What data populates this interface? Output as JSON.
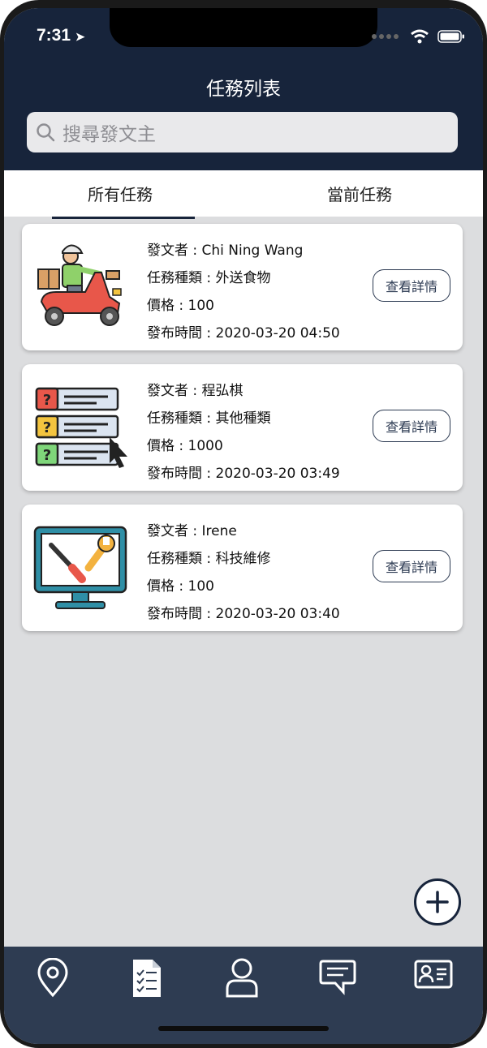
{
  "status": {
    "time": "7:31"
  },
  "header": {
    "title": "任務列表"
  },
  "search": {
    "placeholder": "搜尋發文主"
  },
  "tabs": [
    {
      "label": "所有任務"
    },
    {
      "label": "當前任務"
    }
  ],
  "tasks": [
    {
      "poster": "發文者 : Chi Ning Wang",
      "type": "任務種類 : 外送食物",
      "price": "價格 : 100",
      "time": "發布時間 : 2020-03-20 04:50",
      "icon": "delivery-scooter-icon",
      "button": "查看詳情"
    },
    {
      "poster": "發文者 : 程弘棋",
      "type": "任務種類 : 其他種類",
      "price": "價格 : 1000",
      "time": "發布時間 : 2020-03-20 03:49",
      "icon": "question-list-icon",
      "button": "查看詳情"
    },
    {
      "poster": "發文者 : Irene",
      "type": "任務種類 : 科技維修",
      "price": "價格 : 100",
      "time": "發布時間 : 2020-03-20 03:40",
      "icon": "repair-monitor-icon",
      "button": "查看詳情"
    }
  ],
  "fab": {
    "icon": "plus-icon"
  },
  "tabbar": [
    "location-pin-icon",
    "task-list-icon",
    "user-icon",
    "chat-icon",
    "id-card-icon"
  ],
  "colors": {
    "header": "#17243b",
    "background": "#dcdddf",
    "tabbar": "#2e3c52"
  }
}
